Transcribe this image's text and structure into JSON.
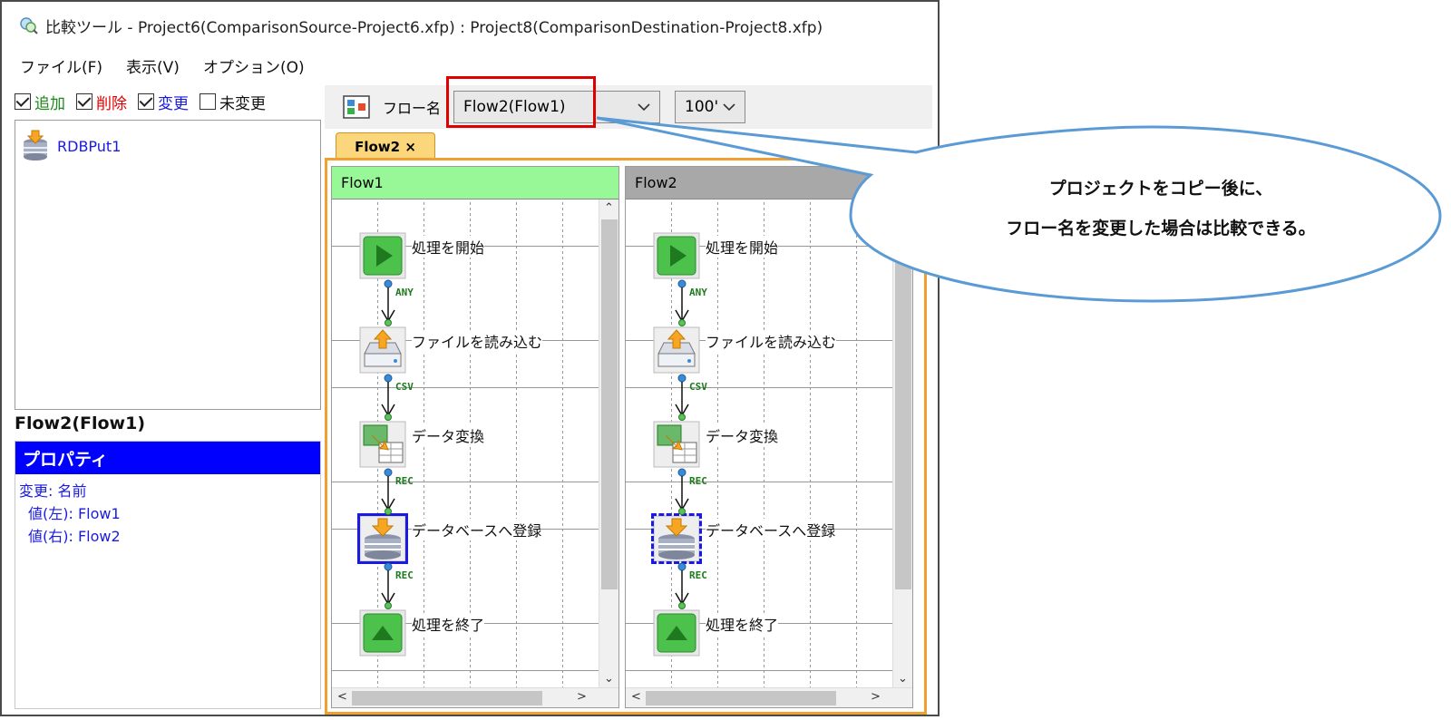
{
  "window": {
    "title": "比較ツール - Project6(ComparisonSource-Project6.xfp) : Project8(ComparisonDestination-Project8.xfp)"
  },
  "menu": {
    "items": [
      "ファイル(F)",
      "表示(V)",
      "オプション(O)"
    ]
  },
  "filters": {
    "items": [
      {
        "label": "追加",
        "checked": true,
        "color": "#1a8a1a"
      },
      {
        "label": "削除",
        "checked": true,
        "color": "#e00000"
      },
      {
        "label": "変更",
        "checked": true,
        "color": "#1a1ae0"
      },
      {
        "label": "未変更",
        "checked": false,
        "color": "#111111"
      }
    ]
  },
  "tree": {
    "items": [
      {
        "label": "RDBPut1",
        "icon": "database-put-icon"
      }
    ]
  },
  "properties": {
    "title": "Flow2(Flow1)",
    "header": "プロパティ",
    "lines": [
      "変更: 名前",
      "  値(左): Flow1",
      "  値(右): Flow2"
    ]
  },
  "toolbar": {
    "flow_label": "フロー名",
    "flow_value": "Flow2(Flow1)",
    "zoom_value": "100'"
  },
  "tab": {
    "label": "Flow2 ×"
  },
  "panes": [
    {
      "header": "Flow1",
      "header_color": "#98f898",
      "selection": "solid"
    },
    {
      "header": "Flow2",
      "header_color": "#a8a8a8",
      "selection": "dashed"
    }
  ],
  "flow": {
    "nodes": [
      {
        "label": "処理を開始",
        "icon": "start-icon"
      },
      {
        "label": "ファイルを読み込む",
        "icon": "file-read-icon"
      },
      {
        "label": "データ変換",
        "icon": "data-convert-icon"
      },
      {
        "label": "データベースへ登録",
        "icon": "database-put-icon"
      },
      {
        "label": "処理を終了",
        "icon": "end-icon"
      }
    ],
    "links": [
      "ANY",
      "CSV",
      "REC",
      "REC"
    ]
  },
  "callout": {
    "lines": [
      "プロジェクトをコピー後に、",
      "フロー名を変更した場合は比較できる。"
    ]
  }
}
